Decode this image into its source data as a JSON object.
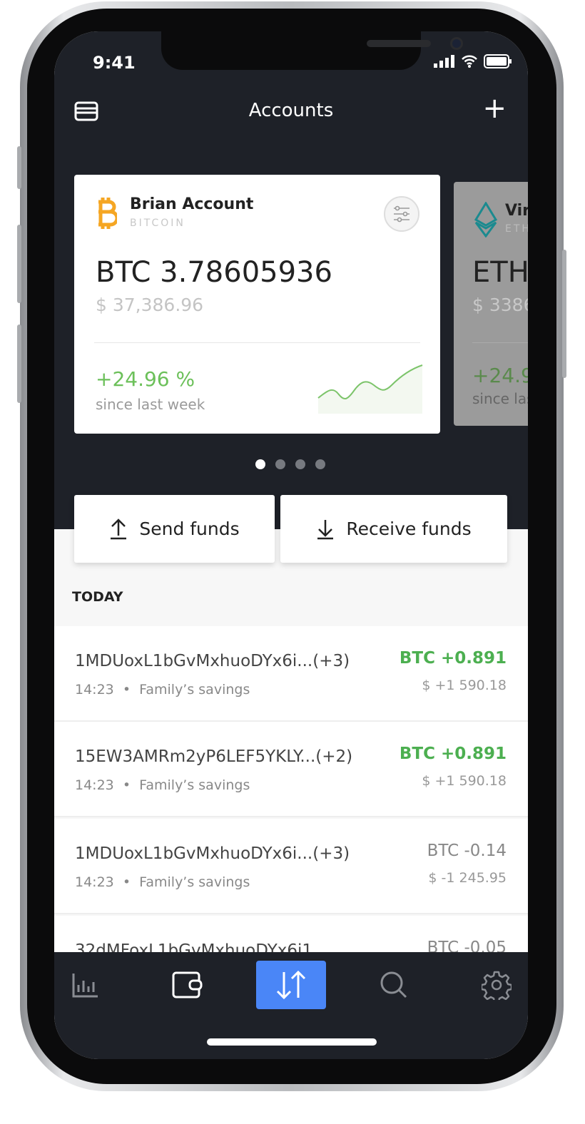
{
  "status": {
    "time": "9:41"
  },
  "header": {
    "title": "Accounts",
    "add_icon": "plus-icon",
    "menu_icon": "cards-icon"
  },
  "cards": [
    {
      "name": "Brian Account",
      "currency": "BITCOIN",
      "balance": "BTC 3.78605936",
      "fiat": "$ 37,386.96",
      "change": "+24.96 %",
      "since": "since last week",
      "icon": "bitcoin-icon",
      "icon_color": "#f5a623",
      "change_color": "#6cc05a"
    },
    {
      "name": "Vir",
      "currency": "ETH",
      "balance": "ETH",
      "fiat": "$ 3386",
      "change": "+24.9",
      "since": "since las",
      "icon": "ethereum-icon",
      "icon_color": "#1b8a8f"
    }
  ],
  "pager": {
    "count": 4,
    "active": 0
  },
  "actions": {
    "send": "Send funds",
    "receive": "Receive funds"
  },
  "section": "TODAY",
  "transactions": [
    {
      "address": "1MDUoxL1bGvMxhuoDYx6i...(+3)",
      "time": "14:23",
      "sep": "•",
      "label": "Family’s savings",
      "amount": "BTC +0.891",
      "fiat": "$ +1 590.18",
      "positive": true
    },
    {
      "address": "15EW3AMRm2yP6LEF5YKLY...(+2)",
      "time": "14:23",
      "sep": "•",
      "label": "Family’s savings",
      "amount": "BTC +0.891",
      "fiat": "$ +1 590.18",
      "positive": true
    },
    {
      "address": "1MDUoxL1bGvMxhuoDYx6i...(+3)",
      "time": "14:23",
      "sep": "•",
      "label": "Family’s savings",
      "amount": "BTC -0.14",
      "fiat": "$ -1 245.95",
      "positive": false
    },
    {
      "address": "32dMFoxL1bGvMxhuoDYx6i1",
      "amount": "BTC -0.05",
      "positive": false
    }
  ],
  "tabs": [
    {
      "icon": "chart-icon"
    },
    {
      "icon": "wallet-icon"
    },
    {
      "icon": "transfer-icon",
      "active": true
    },
    {
      "icon": "search-icon"
    },
    {
      "icon": "settings-icon"
    }
  ],
  "colors": {
    "accent": "#4a86f7",
    "positive": "#4caf50",
    "dark": "#1e2128"
  }
}
